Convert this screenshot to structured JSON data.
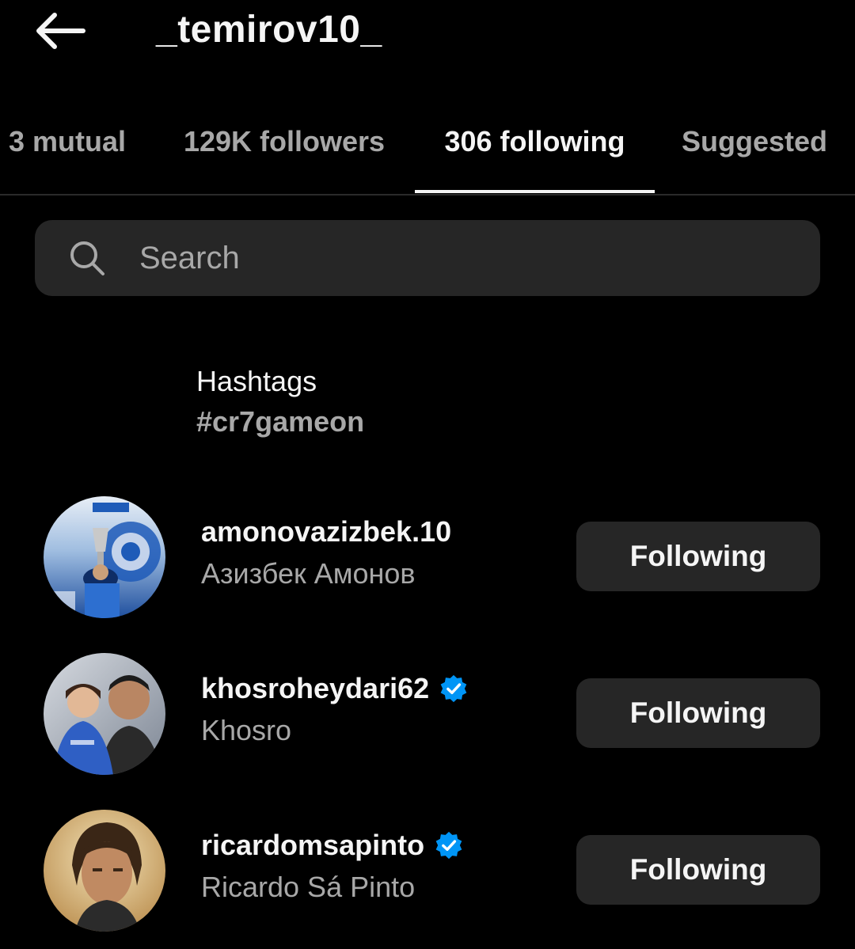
{
  "header": {
    "back_icon": "arrow-left-icon",
    "username": "_temirov10_"
  },
  "tabs": [
    {
      "label": "3 mutual",
      "active": false
    },
    {
      "label": "129K followers",
      "active": false
    },
    {
      "label": "306 following",
      "active": true
    },
    {
      "label": "Suggested",
      "active": false
    }
  ],
  "search": {
    "icon": "search-icon",
    "placeholder": "Search",
    "value": ""
  },
  "hashtags": {
    "title": "Hashtags",
    "tag": "#cr7gameon"
  },
  "users": [
    {
      "handle": "amonovazizbek.10",
      "name": "Азизбек Амонов",
      "verified": false,
      "button_label": "Following"
    },
    {
      "handle": "khosroheydari62",
      "name": "Khosro",
      "verified": true,
      "button_label": "Following"
    },
    {
      "handle": "ricardomsapinto",
      "name": "Ricardo Sá Pinto",
      "verified": true,
      "button_label": "Following"
    }
  ],
  "colors": {
    "background": "#000000",
    "surface": "#262626",
    "text_primary": "#f5f5f5",
    "text_secondary": "#a8a8a8",
    "verified_badge": "#0095f6"
  }
}
